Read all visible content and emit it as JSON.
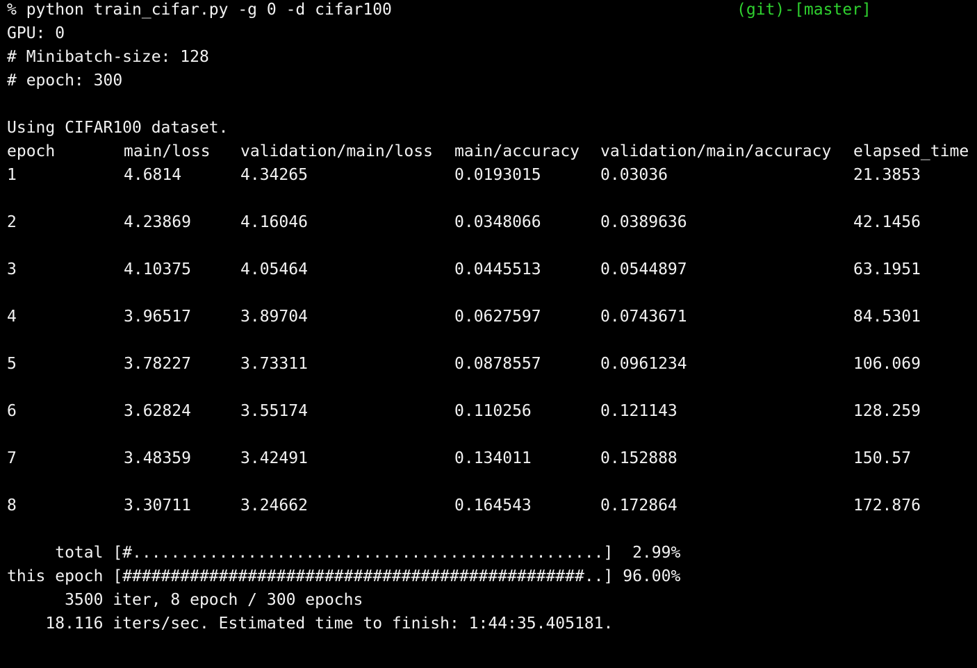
{
  "terminal": {
    "background_color": "#000000",
    "text_color": "#f2f2f2",
    "command_line": "% python train_cifar.py -g 0 -d cifar100",
    "git_status": "(git)-[master]",
    "git_status_color": "#2fd12f",
    "gpu_line": "GPU: 0",
    "minibatch_line": "# Minibatch-size: 128",
    "epoch_line": "# epoch: 300",
    "dataset_line": "Using CIFAR100 dataset."
  },
  "log_table": {
    "headers": [
      "epoch",
      "main/loss",
      "validation/main/loss",
      "main/accuracy",
      "validation/main/accuracy",
      "elapsed_time"
    ],
    "rows": [
      [
        "1",
        "4.6814",
        "4.34265",
        "0.0193015",
        "0.03036",
        "21.3853"
      ],
      [
        "2",
        "4.23869",
        "4.16046",
        "0.0348066",
        "0.0389636",
        "42.1456"
      ],
      [
        "3",
        "4.10375",
        "4.05464",
        "0.0445513",
        "0.0544897",
        "63.1951"
      ],
      [
        "4",
        "3.96517",
        "3.89704",
        "0.0627597",
        "0.0743671",
        "84.5301"
      ],
      [
        "5",
        "3.78227",
        "3.73311",
        "0.0878557",
        "0.0961234",
        "106.069"
      ],
      [
        "6",
        "3.62824",
        "3.55174",
        "0.110256",
        "0.121143",
        "128.259"
      ],
      [
        "7",
        "3.48359",
        "3.42491",
        "0.134011",
        "0.152888",
        "150.57"
      ],
      [
        "8",
        "3.30711",
        "3.24662",
        "0.164543",
        "0.172864",
        "172.876"
      ]
    ]
  },
  "progress": {
    "total_line": "     total [#.................................................]  2.99%",
    "epoch_line": "this epoch [################################################..] 96.00%",
    "iter_line": "      3500 iter, 8 epoch / 300 epochs",
    "speed_line": "    18.116 iters/sec. Estimated time to finish: 1:44:35.405181."
  }
}
